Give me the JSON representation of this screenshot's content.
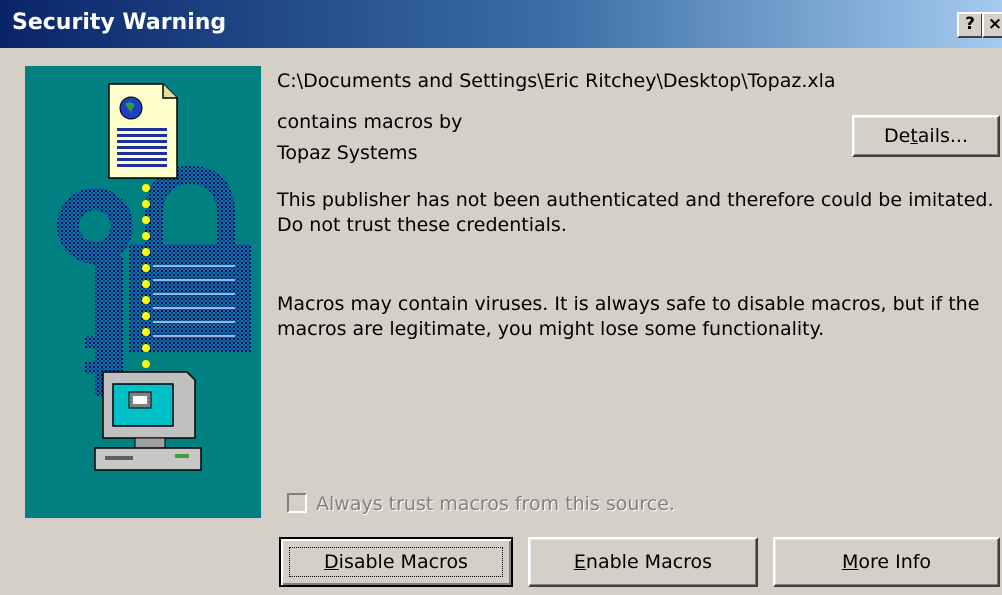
{
  "window": {
    "title": "Security Warning",
    "help_label": "?",
    "close_label": "×"
  },
  "file_path": "C:\\Documents and Settings\\Eric Ritchey\\Desktop\\Topaz.xla",
  "publisher": {
    "intro": "contains macros by",
    "name": "Topaz Systems"
  },
  "details_button": {
    "pre": "De",
    "key": "t",
    "post": "ails..."
  },
  "warning_text": "This publisher has not been authenticated and therefore could be imitated. Do not trust these credentials.",
  "macro_text": "Macros may contain viruses. It is always safe to disable macros, but if the macros are legitimate, you might lose some functionality.",
  "checkbox": {
    "label": "Always trust macros from this source.",
    "checked": false,
    "enabled": false
  },
  "buttons": {
    "disable": {
      "key": "D",
      "rest": "isable Macros"
    },
    "enable": {
      "key": "E",
      "rest": "nable Macros"
    },
    "more": {
      "key": "M",
      "rest": "ore Info"
    }
  },
  "colors": {
    "title_gradient_start": "#0a246a",
    "title_gradient_end": "#a6caf0",
    "art_background": "#008080",
    "dialog_face": "#d4d0c8"
  },
  "icons": {
    "art": "security-certificate-lock-computer-illustration"
  }
}
